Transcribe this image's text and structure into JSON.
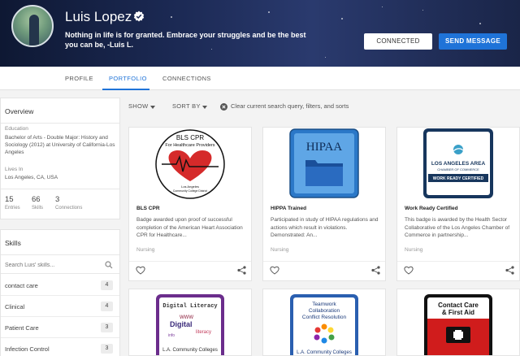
{
  "profile": {
    "name": "Luis Lopez",
    "tagline": "Nothing in life is for granted. Embrace your struggles and be the best you can be, -Luis L.",
    "connected_label": "CONNECTED",
    "send_label": "SEND MESSAGE"
  },
  "tabs": [
    {
      "label": "PROFILE"
    },
    {
      "label": "PORTFOLIO",
      "active": true
    },
    {
      "label": "CONNECTIONS"
    }
  ],
  "overview": {
    "title": "Overview",
    "education_label": "Education",
    "education_value": "Bachelor of Arts - Double Major: History and Sociology (2012) at University of California-Los Angeles",
    "lives_label": "Lives In",
    "lives_value": "Los Angeles, CA, USA",
    "stats": [
      {
        "num": "15",
        "label": "Entries"
      },
      {
        "num": "66",
        "label": "Skills"
      },
      {
        "num": "3",
        "label": "Connections"
      }
    ]
  },
  "skills": {
    "title": "Skills",
    "search_placeholder": "Search Luis' skills...",
    "items": [
      {
        "name": "contact care",
        "count": "4"
      },
      {
        "name": "Clinical",
        "count": "4"
      },
      {
        "name": "Patient Care",
        "count": "3"
      },
      {
        "name": "Infection Control",
        "count": "3"
      }
    ]
  },
  "filters": {
    "show": "SHOW",
    "sort": "SORT BY",
    "clear": "Clear current search query, filters, and sorts"
  },
  "cards": [
    {
      "title": "BLS CPR",
      "desc": "Badge awarded upon proof of successful completion of the American Heart Association CPR for Healthcare...",
      "tag": "Nursing",
      "badge": {
        "line1": "BLS CPR",
        "line2": "For Healthcare Providers",
        "line3": "Los Angeles",
        "line4": "Community College District"
      }
    },
    {
      "title": "HIPPA Trained",
      "desc": "Participated in study of HIPAA regulations and actions which result in violations. Demonstrated: An...",
      "tag": "Nursing",
      "badge": {
        "line1": "HIPAA"
      }
    },
    {
      "title": "Work Ready Certified",
      "desc": "This badge is awarded by the Health Sector Collaborative of the Los Angeles Chamber of Commerce in partnership...",
      "tag": "Nursing",
      "badge": {
        "line1": "LOS ANGELES AREA",
        "line2": "CHAMBER OF COMMERCE",
        "line3": "WORK READY CERTIFIED"
      }
    },
    {
      "badge": {
        "line1": "Digital Literacy",
        "line2": "L.A. Community Colleges"
      }
    },
    {
      "badge": {
        "line1": "Teamwork",
        "line2": "Collaboration",
        "line3": "Conflict Resolution",
        "line4": "L.A. Community Colleges"
      }
    },
    {
      "badge": {
        "line1": "Contact Care",
        "line2": "& First Aid"
      }
    }
  ],
  "colors": {
    "accent": "#1f73d8",
    "header_bg": "#1c2a55"
  }
}
